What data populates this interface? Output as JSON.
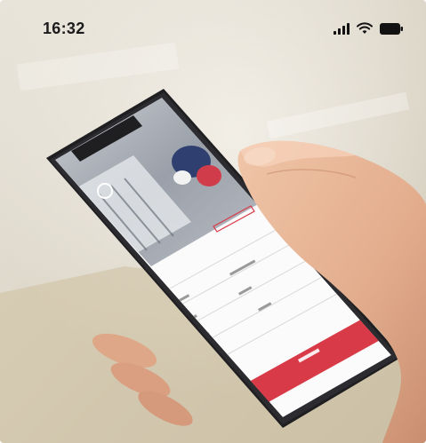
{
  "status_bar": {
    "time": "16:32",
    "signal_icon": "signal-bars-icon",
    "wifi_icon": "wifi-icon",
    "battery_icon": "battery-icon"
  },
  "photo": {
    "subject": "hand-holding-smartphone",
    "colors": {
      "accent": "#d83a48",
      "background": "#dcd6c8",
      "skin": "#e8b89c",
      "phone_frame": "#222224"
    }
  }
}
